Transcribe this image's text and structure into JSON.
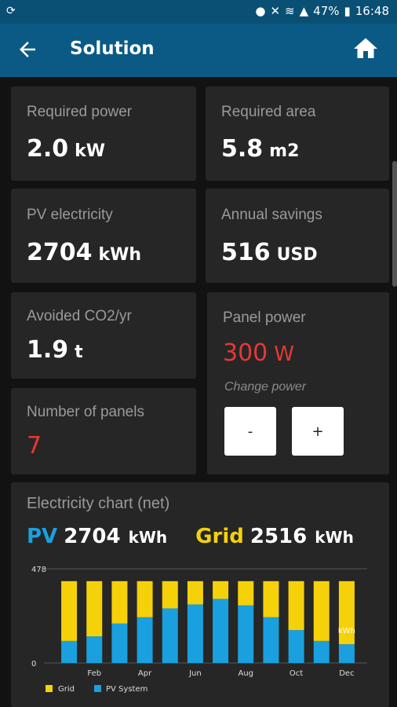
{
  "status": {
    "left_icon": "location-sync-icon",
    "battery": "47%",
    "time": "16:48"
  },
  "appbar": {
    "title": "Solution"
  },
  "cards": {
    "required_power": {
      "label": "Required power",
      "value": "2.0",
      "unit": "kW"
    },
    "required_area": {
      "label": "Required area",
      "value": "5.8",
      "unit": "m2"
    },
    "pv_electricity": {
      "label": "PV electricity",
      "value": "2704",
      "unit": "kWh"
    },
    "annual_savings": {
      "label": "Annual savings",
      "value": "516",
      "unit": "USD"
    },
    "avoided_co2": {
      "label": "Avoided CO2/yr",
      "value": "1.9",
      "unit": "t"
    },
    "panel_power": {
      "label": "Panel power",
      "value": "300",
      "unit": "W",
      "change_label": "Change power",
      "minus": "-",
      "plus": "+"
    },
    "number_of_panels": {
      "label": "Number of panels",
      "value": "7"
    }
  },
  "chart": {
    "title": "Electricity chart (net)",
    "pv_label": "PV",
    "pv_value": "2704",
    "pv_unit": "kWh",
    "grid_label": "Grid",
    "grid_value": "2516",
    "grid_unit": "kWh"
  },
  "chart_data": {
    "type": "bar",
    "stacked": true,
    "categories": [
      "Jan",
      "Feb",
      "Mar",
      "Apr",
      "May",
      "Jun",
      "Jul",
      "Aug",
      "Sep",
      "Oct",
      "Nov",
      "Dec"
    ],
    "tick_labels": [
      "Feb",
      "Apr",
      "Jun",
      "Aug",
      "Oct",
      "Dec"
    ],
    "ylim": [
      0,
      478
    ],
    "ytick_labels": [
      "0",
      "478"
    ],
    "unit_label": "kWh",
    "series": [
      {
        "name": "PV System",
        "color": "#1aa0de",
        "values": [
          112,
          135,
          200,
          232,
          277,
          297,
          325,
          292,
          232,
          167,
          112,
          95
        ]
      },
      {
        "name": "Grid",
        "color": "#f5d10a",
        "values": [
          303,
          280,
          215,
          183,
          138,
          118,
          90,
          123,
          183,
          248,
          303,
          320
        ]
      }
    ],
    "legend_position": "bottom-left",
    "grid": true
  }
}
